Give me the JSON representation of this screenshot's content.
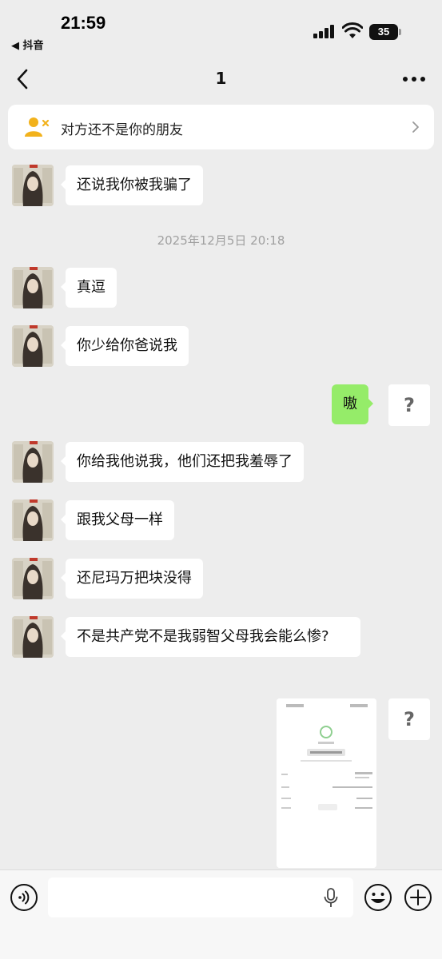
{
  "status_bar": {
    "time": "21:59",
    "back_app": "◀ 抖音",
    "battery": "35"
  },
  "nav": {
    "title": "1"
  },
  "banner": {
    "text": "对方还不是你的朋友"
  },
  "messages": [
    {
      "side": "left",
      "text": "还说我你被我骗了"
    },
    {
      "side": "left",
      "text": "真逗"
    },
    {
      "side": "left",
      "text": "你少给你爸说我"
    },
    {
      "side": "right",
      "text": "嗷"
    },
    {
      "side": "left",
      "text": "你给我他说我，他们还把我羞辱了"
    },
    {
      "side": "left",
      "text": "跟我父母一样"
    },
    {
      "side": "left",
      "text": "还尼玛万把块没得"
    },
    {
      "side": "left",
      "text": "不是共产党不是我弱智父母我会能么惨?"
    },
    {
      "side": "right",
      "type": "image"
    }
  ],
  "timestamp": "2025年12月5日 20:18",
  "unknown_avatar_glyph": "?",
  "colors": {
    "background": "#ededed",
    "sent_bubble": "#95ec69",
    "received_bubble": "#ffffff",
    "banner_icon": "#f2b21c"
  }
}
